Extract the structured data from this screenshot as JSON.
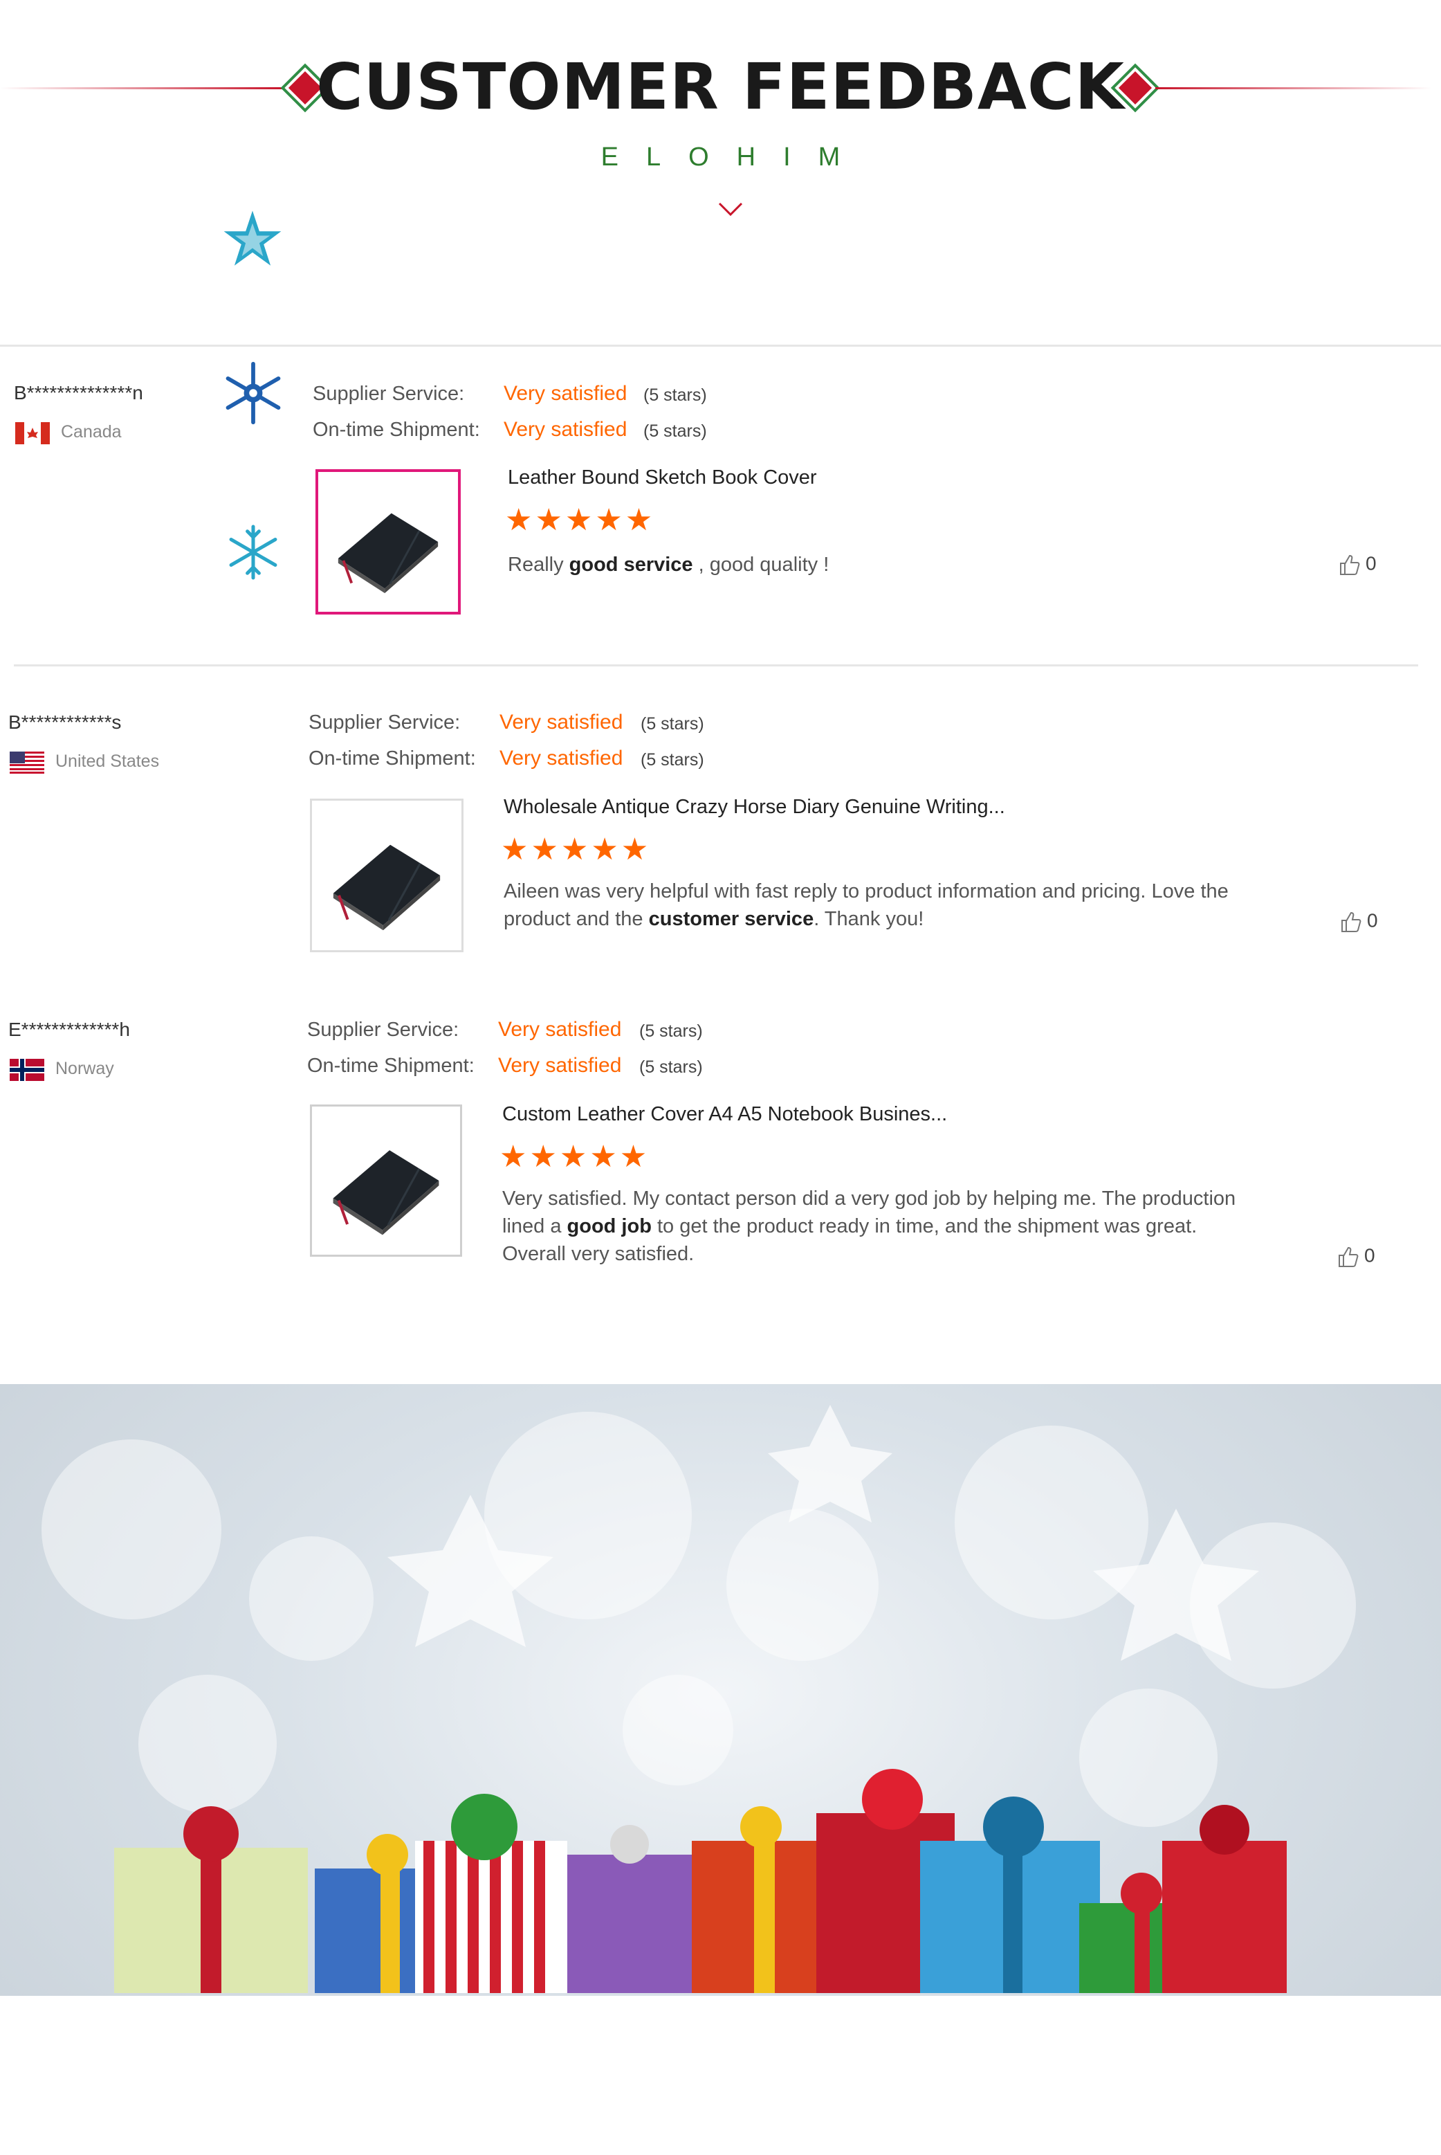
{
  "header": {
    "title": "CUSTOMER FEEDBACK",
    "brand": "ELOHIM"
  },
  "colors": {
    "accent": "#ff6600",
    "brand_green": "#2e7d2e",
    "divider_red": "#c8142a",
    "highlight": "#e0187a"
  },
  "reviews": [
    {
      "name": "B**************n",
      "country": "Canada",
      "flag": "canada-flag",
      "supplier_label": "Supplier Service:",
      "supplier_value": "Very satisfied",
      "supplier_stars": "(5 stars)",
      "shipment_label": "On-time Shipment:",
      "shipment_value": "Very satisfied",
      "shipment_stars": "(5 stars)",
      "product_title": "Leather Bound Sketch Book Cover",
      "rating": 5,
      "comment_pre": "Really ",
      "comment_bold": "good service",
      "comment_post": " , good quality !",
      "likes": "0"
    },
    {
      "name": "B************s",
      "country": "United States",
      "flag": "usa-flag",
      "supplier_label": "Supplier Service:",
      "supplier_value": "Very satisfied",
      "supplier_stars": "(5 stars)",
      "shipment_label": "On-time Shipment:",
      "shipment_value": "Very satisfied",
      "shipment_stars": "(5 stars)",
      "product_title": "Wholesale Antique Crazy Horse Diary Genuine Writing...",
      "rating": 5,
      "comment_pre": "Aileen was very helpful with fast reply to product information and pricing. Love the product and the ",
      "comment_bold": "customer service",
      "comment_post": ". Thank you!",
      "likes": "0"
    },
    {
      "name": "E*************h",
      "country": "Norway",
      "flag": "norway-flag",
      "supplier_label": "Supplier Service:",
      "supplier_value": "Very satisfied",
      "supplier_stars": "(5 stars)",
      "shipment_label": "On-time Shipment:",
      "shipment_value": "Very satisfied",
      "shipment_stars": "(5 stars)",
      "product_title": "Custom Leather Cover A4 A5 Notebook Busines...",
      "rating": 5,
      "comment_pre": "Very satisfied. My contact person did a very god job by helping me. The production lined a ",
      "comment_bold": "good job",
      "comment_post": " to get the product ready in time, and the shipment was great. Overall very satisfied.",
      "likes": "0"
    }
  ],
  "rating_glyphs": "★★★★★"
}
